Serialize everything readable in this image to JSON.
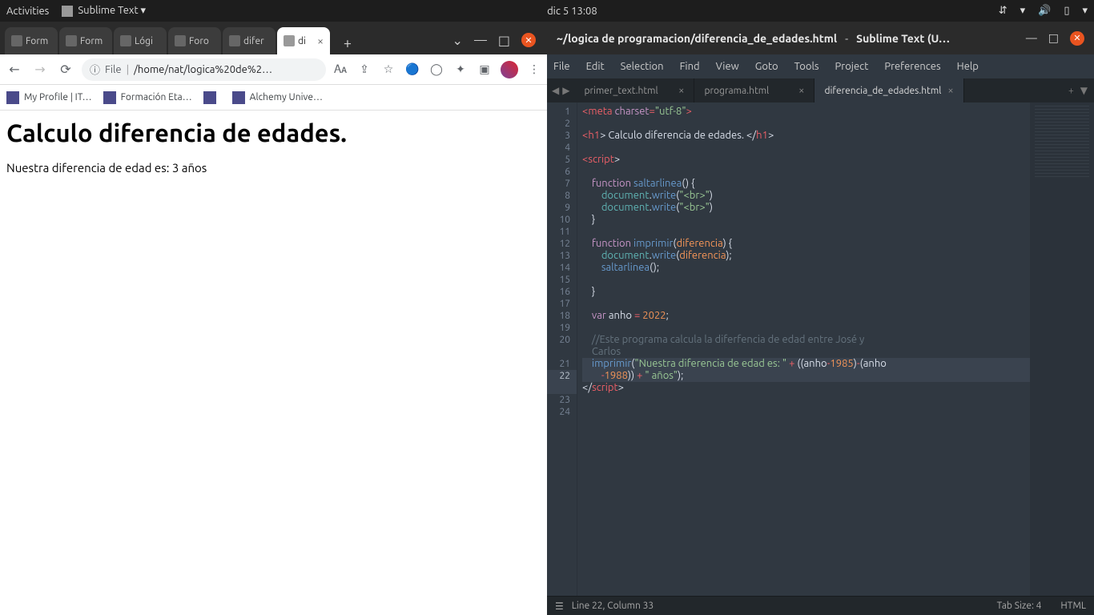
{
  "topbar": {
    "activities": "Activities",
    "app": "Sublime Text ▾",
    "clock": "dic 5  13:08"
  },
  "chrome": {
    "tabs": [
      {
        "label": "Form"
      },
      {
        "label": "Form"
      },
      {
        "label": "Lógi"
      },
      {
        "label": "Foro"
      },
      {
        "label": "difer"
      },
      {
        "label": "di",
        "active": true
      }
    ],
    "url_prefix": "File",
    "url_path": "/home/nat/logica%20de%2…",
    "bookmarks": [
      {
        "label": "My Profile | IT…"
      },
      {
        "label": "Formación Eta…"
      },
      {
        "label": ""
      },
      {
        "label": "Alchemy Unive…"
      }
    ]
  },
  "page": {
    "h1": "Calculo diferencia de edades.",
    "body": "Nuestra diferencia de edad es: 3 años"
  },
  "sublime": {
    "title_path": "~/logica de programacion/diferencia_de_edades.html",
    "title_app": "Sublime Text (U…",
    "menus": [
      "File",
      "Edit",
      "Selection",
      "Find",
      "View",
      "Goto",
      "Tools",
      "Project",
      "Preferences",
      "Help"
    ],
    "tabs": [
      {
        "label": "primer_text.html"
      },
      {
        "label": "programa.html"
      },
      {
        "label": "diferencia_de_edades.html",
        "active": true
      }
    ],
    "status_left": "Line 22, Column 33",
    "status_tab": "Tab Size: 4",
    "status_lang": "HTML",
    "line_numbers": [
      "1",
      "2",
      "3",
      "4",
      "5",
      "6",
      "7",
      "8",
      "9",
      "10",
      "11",
      "12",
      "13",
      "14",
      "15",
      "16",
      "17",
      "18",
      "19",
      "20",
      "21",
      "22",
      "23",
      "24"
    ],
    "code_lines": [
      [
        [
          "red",
          "<"
        ],
        [
          "red",
          "meta "
        ],
        [
          "purple",
          "charset"
        ],
        [
          "red",
          "="
        ],
        [
          "green",
          "\"utf-8\""
        ],
        [
          "red",
          ">"
        ]
      ],
      [],
      [
        [
          "red",
          "<"
        ],
        [
          "red",
          "h1"
        ],
        [
          "fg",
          "> Calculo diferencia de edades. </"
        ],
        [
          "red",
          "h1"
        ],
        [
          "fg",
          ">"
        ]
      ],
      [],
      [
        [
          "red",
          "<"
        ],
        [
          "red",
          "script"
        ],
        [
          "fg",
          ">"
        ]
      ],
      [],
      [
        [
          "fg",
          "    "
        ],
        [
          "purple tk-it",
          "function"
        ],
        [
          "fg",
          " "
        ],
        [
          "blue",
          "saltarlinea"
        ],
        [
          "fg",
          "() {"
        ]
      ],
      [
        [
          "fg",
          "        "
        ],
        [
          "cyan tk-it",
          "document"
        ],
        [
          "fg",
          "."
        ],
        [
          "blue",
          "write"
        ],
        [
          "fg",
          "("
        ],
        [
          "green",
          "\"<br>\""
        ],
        [
          "fg",
          ")"
        ]
      ],
      [
        [
          "fg",
          "        "
        ],
        [
          "cyan tk-it",
          "document"
        ],
        [
          "fg",
          "."
        ],
        [
          "blue",
          "write"
        ],
        [
          "fg",
          "("
        ],
        [
          "green",
          "\"<br>\""
        ],
        [
          "fg",
          ")"
        ]
      ],
      [
        [
          "fg",
          "    }"
        ]
      ],
      [],
      [
        [
          "fg",
          "    "
        ],
        [
          "purple tk-it",
          "function"
        ],
        [
          "fg",
          " "
        ],
        [
          "blue",
          "imprimir"
        ],
        [
          "fg",
          "("
        ],
        [
          "orange",
          "diferencia"
        ],
        [
          "fg",
          ") {"
        ]
      ],
      [
        [
          "fg",
          "        "
        ],
        [
          "cyan tk-it",
          "document"
        ],
        [
          "fg",
          "."
        ],
        [
          "blue",
          "write"
        ],
        [
          "fg",
          "("
        ],
        [
          "orange",
          "diferencia"
        ],
        [
          "fg",
          ");"
        ]
      ],
      [
        [
          "fg",
          "        "
        ],
        [
          "blue",
          "saltarlinea"
        ],
        [
          "fg",
          "();"
        ]
      ],
      [],
      [
        [
          "fg",
          "    }"
        ]
      ],
      [],
      [
        [
          "fg",
          "    "
        ],
        [
          "purple tk-it",
          "var"
        ],
        [
          "fg",
          " anho "
        ],
        [
          "red",
          "="
        ],
        [
          "fg",
          " "
        ],
        [
          "orange",
          "2022"
        ],
        [
          "fg",
          ";"
        ]
      ],
      [],
      [
        [
          "fg",
          "    "
        ],
        [
          "grey",
          "//Este programa calcula la diferfencia de edad entre José y"
        ]
      ],
      [
        [
          "fg",
          "    "
        ],
        [
          "grey",
          "Carlos"
        ]
      ],
      [
        [
          "fg",
          "    "
        ],
        [
          "blue",
          "imprimir"
        ],
        [
          "fg",
          "("
        ],
        [
          "green",
          "\"Nuestra diferencia"
        ],
        [
          "fg",
          " "
        ],
        [
          "green",
          "de edad es: \""
        ],
        [
          "fg",
          " "
        ],
        [
          "red",
          "+"
        ],
        [
          "fg",
          " ((anho"
        ],
        [
          "red",
          "-"
        ],
        [
          "orange",
          "1985"
        ],
        [
          "fg",
          ")"
        ],
        [
          "red",
          "-"
        ],
        [
          "fg",
          "(anho"
        ]
      ],
      [
        [
          "fg",
          "        "
        ],
        [
          "red",
          "-"
        ],
        [
          "orange",
          "1988"
        ],
        [
          "fg",
          ")) "
        ],
        [
          "red",
          "+"
        ],
        [
          "fg",
          " "
        ],
        [
          "green",
          "\" años\""
        ],
        [
          "fg",
          ");"
        ]
      ],
      [
        [
          "fg",
          "</"
        ],
        [
          "red",
          "script"
        ],
        [
          "fg",
          ">"
        ]
      ]
    ],
    "highlight_line": 22,
    "wrap_line": 20
  }
}
